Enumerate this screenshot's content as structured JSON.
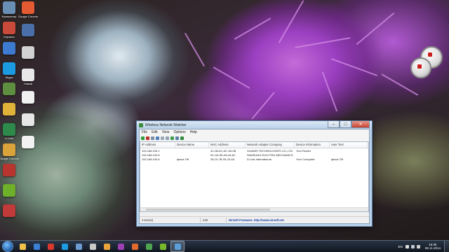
{
  "desktop": {
    "icons": [
      {
        "name": "desktop-icon-computer",
        "label": "Компьютер",
        "color": "#6a8fb5"
      },
      {
        "name": "desktop-icon-user",
        "label": "Корзина",
        "color": "#c94a3a"
      },
      {
        "name": "desktop-icon-network",
        "label": "",
        "color": "#3d7bd1"
      },
      {
        "name": "desktop-icon-skype",
        "label": "Skype",
        "color": "#1d9be0"
      },
      {
        "name": "desktop-icon-control",
        "label": "",
        "color": "#5e8e3f"
      },
      {
        "name": "desktop-icon-folder",
        "label": "",
        "color": "#e0b23a"
      },
      {
        "name": "desktop-icon-dlink",
        "label": "D-Link",
        "color": "#2d8a4a"
      },
      {
        "name": "desktop-icon-chrome",
        "label": "Google Chrome",
        "color": "#d9a23a"
      },
      {
        "name": "desktop-icon-app1",
        "label": "",
        "color": "#b8342e"
      },
      {
        "name": "desktop-icon-nvidia",
        "label": "",
        "color": "#6fb02a"
      },
      {
        "name": "desktop-icon-app2",
        "label": "",
        "color": "#c13a3a"
      }
    ],
    "icons2": [
      {
        "name": "desktop-icon-chrome-top",
        "label": "Google Chrome",
        "color": "#e45b33"
      },
      {
        "name": "desktop-icon-doc1",
        "label": "",
        "color": "#4a6fa8"
      },
      {
        "name": "desktop-icon-doc2",
        "label": "",
        "color": "#d2d2d2"
      },
      {
        "name": "desktop-icon-doc3",
        "label": "Новый",
        "color": "#e8e8e8"
      },
      {
        "name": "desktop-icon-doc4",
        "label": "",
        "color": "#f0f0f0"
      },
      {
        "name": "desktop-icon-doc5",
        "label": "",
        "color": "#e6e6e6"
      },
      {
        "name": "desktop-icon-doc6",
        "label": "",
        "color": "#f2f2f2"
      }
    ]
  },
  "window": {
    "title": "Wireless Network Watcher",
    "buttons": {
      "minimize": "–",
      "maximize": "□",
      "close": "✕"
    },
    "menu": [
      "File",
      "Edit",
      "View",
      "Options",
      "Help"
    ],
    "columns": [
      "IP Address",
      "Device Name",
      "MAC Address",
      "Network Adapter Company",
      "Device Information",
      "User Text"
    ],
    "rows": [
      [
        "192.168.100.1",
        "",
        "4C-85-6C-6C-1B-0B",
        "HUAWEI TECHNOLOGIES CO.,LTD",
        "Your Router",
        ""
      ],
      [
        "192.168.100.5",
        "",
        "5C-A3-9D-46-49-6C",
        "SAMSUNG ELECTRO-MECHANICS ...",
        "",
        ""
      ],
      [
        "192.168.100.6",
        "фишт-ПК",
        "28-10-7B-05-23-4A",
        "D-Link International",
        "Your Computer",
        "фишт-ПК"
      ]
    ],
    "status": {
      "items": "3 item(s)",
      "count": "249",
      "nirsoft": "NirSoft Freeware.  http://www.nirsoft.net"
    }
  },
  "taskbar": {
    "apps": [
      {
        "name": "taskbar-explorer",
        "color": "#f0c24a"
      },
      {
        "name": "taskbar-wmp",
        "color": "#3a7fd3"
      },
      {
        "name": "taskbar-yandex",
        "color": "#d8382e"
      },
      {
        "name": "taskbar-skype",
        "color": "#1d9be0"
      },
      {
        "name": "taskbar-mail",
        "color": "#6d9bd1"
      },
      {
        "name": "taskbar-notes",
        "color": "#c9c9c9"
      },
      {
        "name": "taskbar-chrome",
        "color": "#e8a33a"
      },
      {
        "name": "taskbar-winrar",
        "color": "#9b3fb1"
      },
      {
        "name": "taskbar-media",
        "color": "#e06a2e"
      },
      {
        "name": "taskbar-calc",
        "color": "#4ea54e"
      },
      {
        "name": "taskbar-nvidia",
        "color": "#76b82a"
      },
      {
        "name": "taskbar-wnw",
        "color": "#5a9fd8",
        "active": true
      }
    ],
    "lang": "EN",
    "time": "16:35",
    "date": "08.11.2014"
  }
}
